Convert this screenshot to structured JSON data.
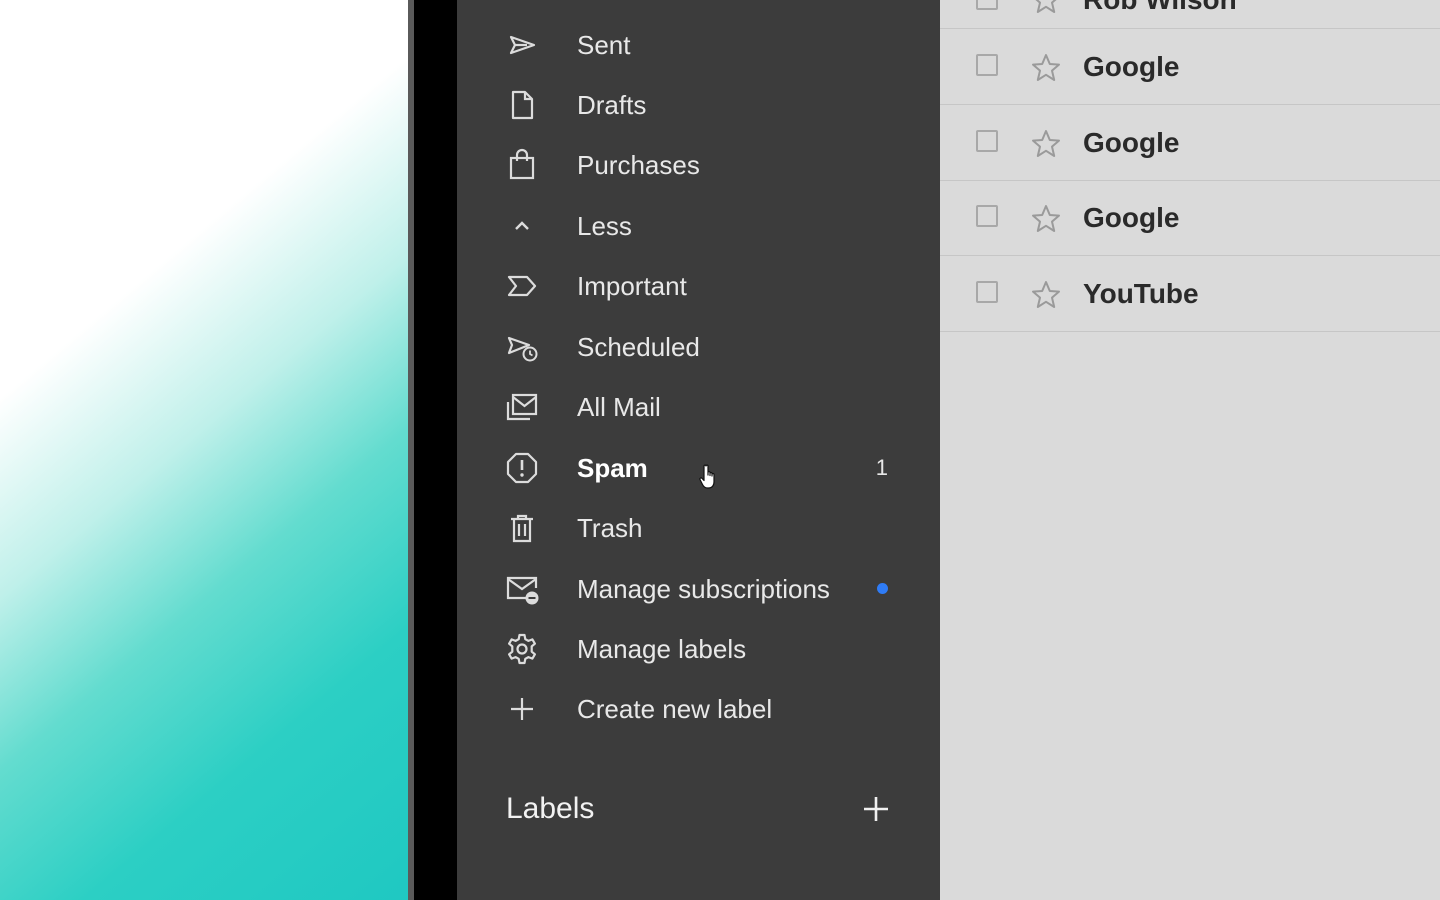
{
  "nav": {
    "items": [
      {
        "label": "Sent",
        "icon": "send-icon"
      },
      {
        "label": "Drafts",
        "icon": "draft-icon"
      },
      {
        "label": "Purchases",
        "icon": "shopping-bag-icon"
      },
      {
        "label": "Less",
        "icon": "chevron-up-icon"
      },
      {
        "label": "Important",
        "icon": "important-icon"
      },
      {
        "label": "Scheduled",
        "icon": "scheduled-send-icon"
      },
      {
        "label": "All Mail",
        "icon": "all-mail-icon"
      },
      {
        "label": "Spam",
        "icon": "spam-icon",
        "count": "1"
      },
      {
        "label": "Trash",
        "icon": "trash-icon"
      },
      {
        "label": "Manage subscriptions",
        "icon": "manage-subscriptions-icon",
        "indicator_color": "#2f7cf6"
      },
      {
        "label": "Manage labels",
        "icon": "gear-icon"
      },
      {
        "label": "Create new label",
        "icon": "plus-icon"
      }
    ]
  },
  "labels_section": {
    "heading": "Labels"
  },
  "mail_list": {
    "partial_row": {
      "sender": "Rob Wilson"
    },
    "rows": [
      {
        "sender": "Google"
      },
      {
        "sender": "Google"
      },
      {
        "sender": "Google"
      },
      {
        "sender": "YouTube"
      }
    ]
  },
  "colors": {
    "sidebar_bg": "#3c3c3c",
    "list_bg": "#dadada",
    "accent_dot": "#2f7cf6"
  }
}
